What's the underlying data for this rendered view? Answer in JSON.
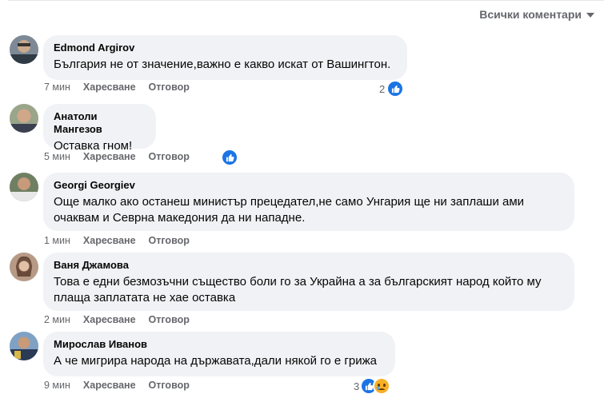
{
  "sort": {
    "label": "Всички коментари"
  },
  "comments": [
    {
      "author": "Edmond Argirov",
      "text": "България не от значение,важно е какво искат от Вашингтон.",
      "time": "7 мин",
      "like_label": "Харесване",
      "reply_label": "Отговор",
      "reactions": {
        "count": "2",
        "types": [
          "like-icon"
        ]
      }
    },
    {
      "author": "Анатоли Мангезов",
      "text": "Оставка гном!",
      "time": "5 мин",
      "like_label": "Харесване",
      "reply_label": "Отговор",
      "reactions": {
        "count": "",
        "types": [
          "like-icon"
        ]
      }
    },
    {
      "author": "Georgi Georgiev",
      "text": "Още малко ако останеш министър прецедател,не само Унгария ще ни заплаши ами\nочаквам и Севрна македония да ни нападне.",
      "time": "1 мин",
      "like_label": "Харесване",
      "reply_label": "Отговор",
      "reactions": null
    },
    {
      "author": "Ваня Джамова",
      "text": "Това е едни безмозъчни същество боли го за Украйна а за българският народ който му\nплаща заплатата не хае оставка",
      "time": "2 мин",
      "like_label": "Харесване",
      "reply_label": "Отговор",
      "reactions": null
    },
    {
      "author": "Мирослав Иванов",
      "text": "А че мигрира народа на държавата,дали някой го е грижа",
      "time": "9 мин",
      "like_label": "Харесване",
      "reply_label": "Отговор",
      "reactions": {
        "count": "3",
        "types": [
          "like-icon",
          "sad-icon"
        ]
      }
    }
  ]
}
